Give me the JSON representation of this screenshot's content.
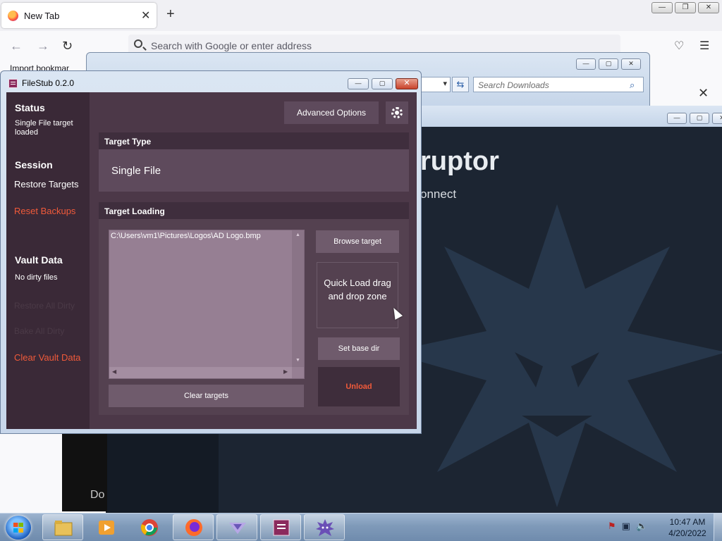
{
  "firefox": {
    "tab_title": "New Tab",
    "url_placeholder": "Search with Google or enter address",
    "bookmark_text": "Import bookmar"
  },
  "downloads": {
    "search_placeholder": "Search Downloads"
  },
  "rtc": {
    "title_fragment": "ruptor",
    "subtitle_fragment": "onnect",
    "left_fragment": "Do"
  },
  "filestub": {
    "window_title": "FileStub 0.2.0",
    "sidebar": {
      "status_heading": "Status",
      "status_text": "Single File target loaded",
      "session_heading": "Session",
      "restore_targets": "Restore Targets",
      "reset_backups": "Reset Backups",
      "vault_heading": "Vault Data",
      "vault_text": "No dirty files",
      "restore_all_dirty": "Restore All Dirty",
      "bake_all_dirty": "Bake All Dirty",
      "clear_vault_data": "Clear Vault Data"
    },
    "advanced_options": "Advanced Options",
    "target_type_heading": "Target Type",
    "target_type_value": "Single File",
    "target_loading_heading": "Target Loading",
    "target_path": "C:\\Users\\vm1\\Pictures\\Logos\\AD Logo.bmp",
    "browse_target": "Browse target",
    "quick_load": "Quick Load drag and drop zone",
    "set_base_dir": "Set base dir",
    "unload": "Unload",
    "clear_targets": "Clear targets"
  },
  "taskbar": {
    "time": "10:47 AM",
    "date": "4/20/2022"
  },
  "colors": {
    "filestub_bg": "#4c3848",
    "filestub_sidebar": "#3a2937",
    "accent_red": "#f05a3a",
    "rtc_bg": "#1c2532"
  }
}
